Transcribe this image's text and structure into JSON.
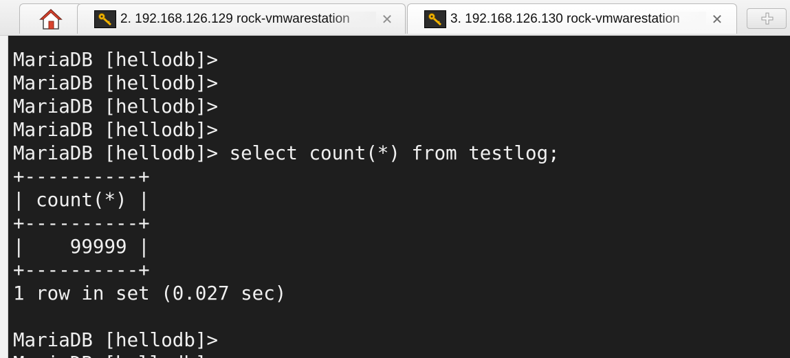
{
  "tabs": [
    {
      "label": "2. 192.168.126.129 rock-vmwarestation",
      "close": "✕"
    },
    {
      "label": "3. 192.168.126.130 rock-vmwarestation",
      "close": "✕"
    }
  ],
  "new_tab_label": "+",
  "terminal": {
    "lines": [
      "MariaDB [hellodb]>",
      "MariaDB [hellodb]>",
      "MariaDB [hellodb]>",
      "MariaDB [hellodb]>",
      "MariaDB [hellodb]> select count(*) from testlog;",
      "+----------+",
      "| count(*) |",
      "+----------+",
      "|    99999 |",
      "+----------+",
      "1 row in set (0.027 sec)",
      "",
      "MariaDB [hellodb]>",
      "MariaDB [hellodb]>"
    ]
  },
  "colors": {
    "terminal_bg": "#1e1e1e",
    "terminal_fg": "#f0f0f0",
    "home_roof": "#d9442f",
    "key_icon_bg": "#2c2c2c",
    "key_color": "#f2b300"
  },
  "icons": {
    "home": "home-icon",
    "tab_session": "key-icon",
    "close": "close-icon",
    "new_tab": "plus-icon"
  }
}
